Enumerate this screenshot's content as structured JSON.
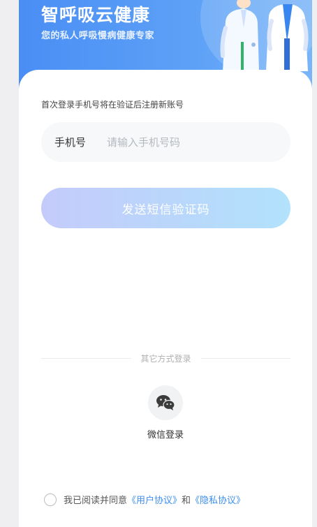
{
  "header": {
    "title": "智呼吸云健康",
    "subtitle": "您的私人呼吸慢病健康专家"
  },
  "login": {
    "hint": "首次登录手机号将在验证后注册新账号",
    "phone_label": "手机号",
    "phone_placeholder": "请输入手机号码",
    "phone_value": "",
    "send_code_label": "发送短信验证码"
  },
  "other_login": {
    "divider_text": "其它方式登录",
    "wechat_label": "微信登录"
  },
  "agreement": {
    "prefix": "我已阅读并同意",
    "user_agreement": "《用户协议》",
    "conjunction": "和",
    "privacy_agreement": "《隐私协议》",
    "checked": false
  },
  "colors": {
    "brand_blue": "#4a8ef5",
    "link_blue": "#3c8ef1",
    "button_gradient_start": "#c4cbfb",
    "button_gradient_end": "#b2e2fc"
  },
  "icons": {
    "wechat": "wechat-icon",
    "checkbox": "radio-circle"
  }
}
